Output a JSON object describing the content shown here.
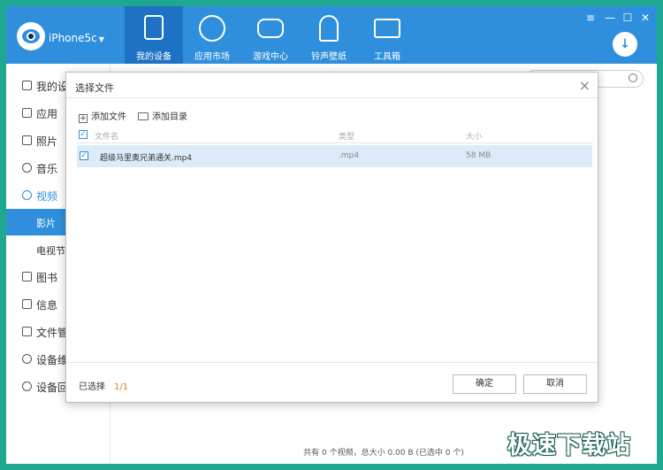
{
  "header": {
    "device_name": "iPhone5c",
    "tabs": [
      {
        "label": "我的设备",
        "icon": "device-icon"
      },
      {
        "label": "应用市场",
        "icon": "apps-icon"
      },
      {
        "label": "游戏中心",
        "icon": "gamepad-icon"
      },
      {
        "label": "铃声壁纸",
        "icon": "bell-icon"
      },
      {
        "label": "工具箱",
        "icon": "toolbox-icon"
      }
    ],
    "window_controls": {
      "menu": "≡",
      "minimize": "—",
      "maximize": "☐",
      "close": "✕"
    },
    "download_icon": "download-icon"
  },
  "sidebar": {
    "items": [
      {
        "label": "我的设",
        "icon": "device-icon"
      },
      {
        "label": "应用",
        "icon": "apps-icon"
      },
      {
        "label": "照片",
        "icon": "photo-icon"
      },
      {
        "label": "音乐",
        "icon": "music-icon"
      },
      {
        "label": "视频",
        "icon": "video-icon"
      },
      {
        "label": "影片",
        "icon": ""
      },
      {
        "label": "电视节",
        "icon": ""
      },
      {
        "label": "图书",
        "icon": "book-icon"
      },
      {
        "label": "信息",
        "icon": "message-icon"
      },
      {
        "label": "文件管",
        "icon": "folder-icon"
      },
      {
        "label": "设备维",
        "icon": "shield-icon"
      },
      {
        "label": "设备回",
        "icon": "restore-icon"
      }
    ]
  },
  "status_bar": "共有 0 个视频，总大小 0.00 B (已选中 0 个)",
  "dialog": {
    "title": "选择文件",
    "close": "×",
    "toolbar": {
      "add_file": "添加文件",
      "add_folder": "添加目录"
    },
    "columns": {
      "name": "文件名",
      "type": "类型",
      "size": "大小"
    },
    "files": [
      {
        "name": "超级马里奥兄弟通关.mp4",
        "type": ".mp4",
        "size": "58 MB",
        "checked": true
      }
    ],
    "selected_label": "已选择",
    "selected_count": "1/1",
    "ok_label": "确定",
    "cancel_label": "取消"
  },
  "watermark": "极速下载站",
  "colors": {
    "accent": "#2f8fdc",
    "accent_dark": "#1d72c4",
    "frame": "#1fa88f",
    "row_selected": "#dcebf9",
    "count": "#e27a1f"
  }
}
